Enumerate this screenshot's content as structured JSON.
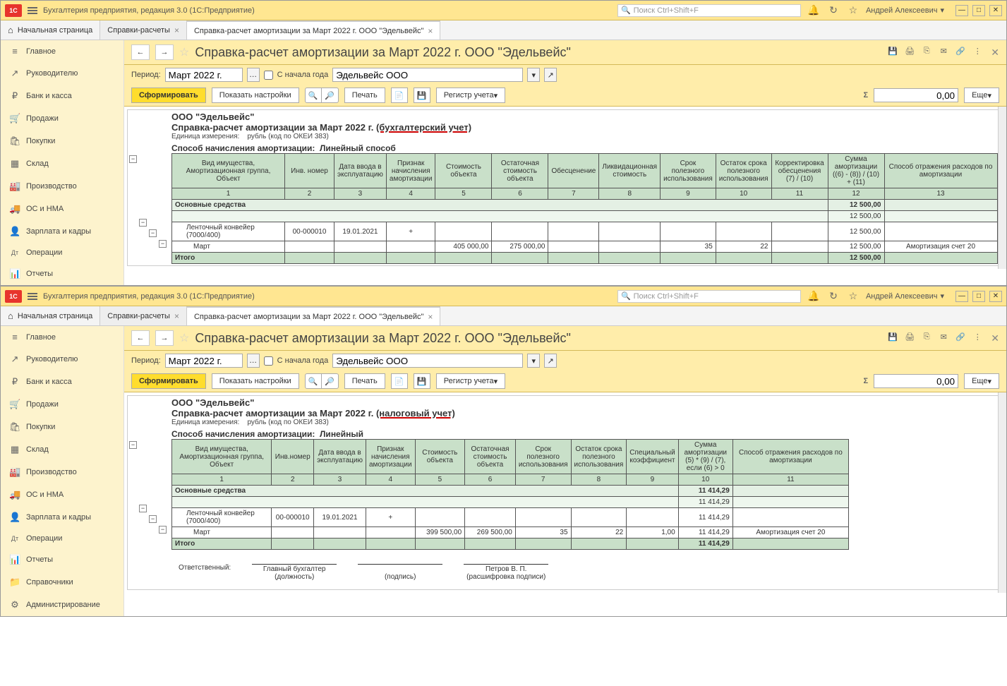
{
  "titlebar": {
    "app_title": "Бухгалтерия предприятия, редакция 3.0  (1С:Предприятие)",
    "search_placeholder": "Поиск Ctrl+Shift+F",
    "user": "Андрей Алексеевич"
  },
  "tabs": {
    "home": "Начальная страница",
    "t1": "Справки-расчеты",
    "t2": "Справка-расчет амортизации за Март 2022 г. ООО \"Эдельвейс\""
  },
  "sidebar": {
    "items": [
      {
        "label": "Главное",
        "icon": "≡"
      },
      {
        "label": "Руководителю",
        "icon": "↗"
      },
      {
        "label": "Банк и касса",
        "icon": "₽"
      },
      {
        "label": "Продажи",
        "icon": "🛒"
      },
      {
        "label": "Покупки",
        "icon": "🛍"
      },
      {
        "label": "Склад",
        "icon": "▦"
      },
      {
        "label": "Производство",
        "icon": "🏭"
      },
      {
        "label": "ОС и НМА",
        "icon": "🚚"
      },
      {
        "label": "Зарплата и кадры",
        "icon": "👤"
      },
      {
        "label": "Операции",
        "icon": "Дт"
      },
      {
        "label": "Отчеты",
        "icon": "📊"
      },
      {
        "label": "Справочники",
        "icon": "📁"
      },
      {
        "label": "Администрирование",
        "icon": "⚙"
      }
    ]
  },
  "doc_title": "Справка-расчет амортизации за Март 2022 г. ООО \"Эдельвейс\"",
  "params": {
    "period_label": "Период:",
    "period_value": "Март 2022 г.",
    "from_start_label": "С начала года",
    "org": "Эдельвейс ООО"
  },
  "toolbar": {
    "generate": "Сформировать",
    "settings": "Показать настройки",
    "print": "Печать",
    "register": "Регистр учета",
    "more": "Еще",
    "total": "0,00"
  },
  "report": {
    "company": "ООО \"Эдельвейс\"",
    "unit_line": "рубль (код по ОКЕИ 383)",
    "unit_label": "Единица измерения:",
    "method_label": "Способ начисления амортизации:",
    "resp_label": "Ответственный:",
    "position_label": "(должность)",
    "sign_label": "(подпись)",
    "decode_label": "(расшифровка подписи)",
    "chief_acc": "Главный бухгалтер",
    "person": "Петров В. П."
  },
  "top": {
    "title": "Справка-расчет амортизации за Март 2022 г. ",
    "mode": "(бухгалтерский учет)",
    "method": "Линейный способ",
    "headers": {
      "h1": "Вид имущества,\nАмортизационная группа,\nОбъект",
      "h2": "Инв. номер",
      "h3": "Дата ввода в эксплуатацию",
      "h4": "Признак начисления амортизации",
      "h5": "Стоимость объекта",
      "h6": "Остаточная стоимость объекта",
      "h7": "Обесценение",
      "h8": "Ликвидационная стоимость",
      "h9": "Срок полезного использования",
      "h10": "Остаток срока полезного использования",
      "h11": "Корректировка обесценения\n(7) / (10)",
      "h12": "Сумма амортизации ((6) - (8)) / (10) + (11)",
      "h13": "Способ отражения расходов по амортизации"
    },
    "group": "Основные средства",
    "group_sum": "12 500,00",
    "sub_sum": "12 500,00",
    "asset": "Ленточный конвейер (7000/400)",
    "inv": "00-000010",
    "date": "19.01.2021",
    "flag": "+",
    "asset_sum": "12 500,00",
    "month": "Март",
    "month_cost": "405 000,00",
    "month_rest": "275 000,00",
    "month_srok": "35",
    "month_ost": "22",
    "month_sum": "12 500,00",
    "expense": "Амортизация счет 20",
    "total": "Итого",
    "total_sum": "12 500,00"
  },
  "bottom": {
    "title": "Справка-расчет амортизации за Март 2022 г. ",
    "mode": "(налоговый учет)",
    "method": "Линейный",
    "headers": {
      "h1": "Вид имущества,\nАмортизационная группа,\nОбъект",
      "h2": "Инв.номер",
      "h3": "Дата ввода в эксплуатацию",
      "h4": "Признак начисления амортизации",
      "h5": "Стоимость объекта",
      "h6": "Остаточная стоимость объекта",
      "h7": "Срок полезного использования",
      "h8": "Остаток срока полезного использования",
      "h9": "Специальный коэффициент",
      "h10": "Сумма амортизации (5) * (9) / (7), если (6) > 0",
      "h11": "Способ отражения расходов по амортизации"
    },
    "group": "Основные средства",
    "group_sum": "11 414,29",
    "sub_sum": "11 414,29",
    "asset": "Ленточный конвейер (7000/400)",
    "inv": "00-000010",
    "date": "19.01.2021",
    "flag": "+",
    "asset_sum": "11 414,29",
    "month": "Март",
    "month_cost": "399 500,00",
    "month_rest": "269 500,00",
    "month_srok": "35",
    "month_ost": "22",
    "month_coef": "1,00",
    "month_sum": "11 414,29",
    "expense": "Амортизация счет 20",
    "total": "Итого",
    "total_sum": "11 414,29"
  }
}
